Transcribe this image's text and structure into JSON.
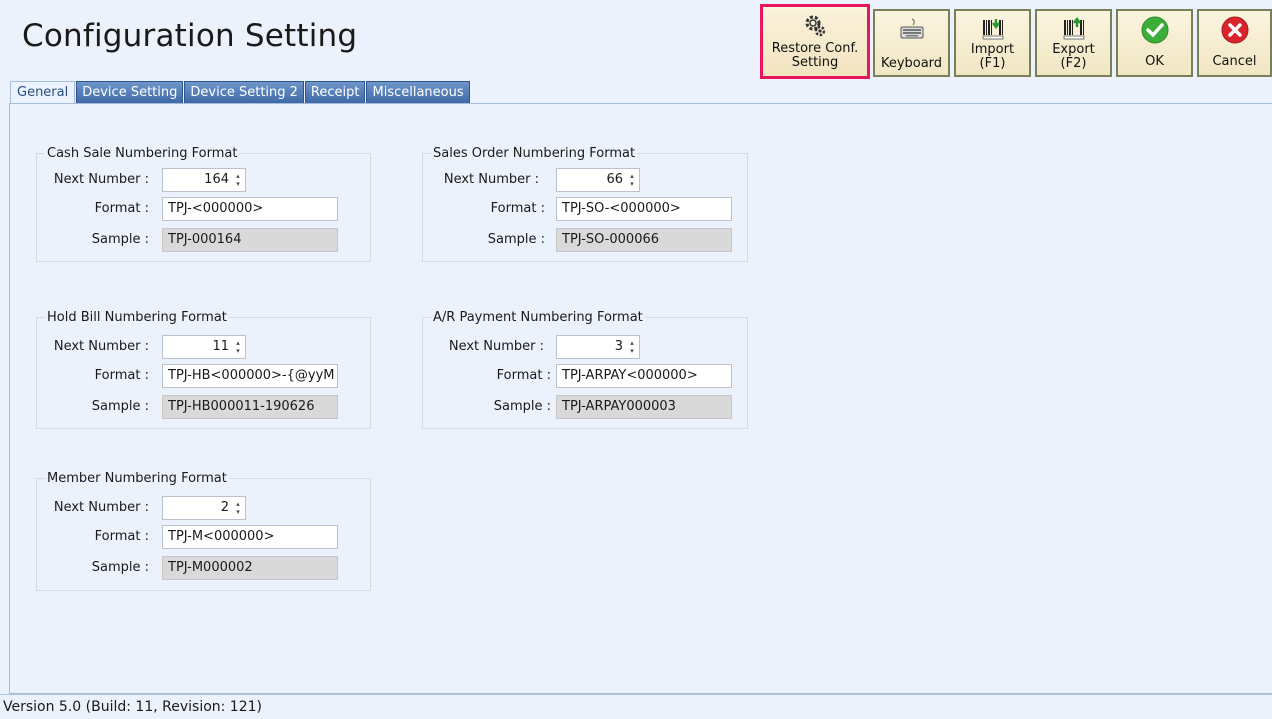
{
  "window": {
    "title": "Configuration Setting"
  },
  "toolbar": {
    "restore_label_1": "Restore Conf.",
    "restore_label_2": "Setting",
    "keyboard_label": "Keyboard",
    "import_label_1": "Import",
    "import_label_2": "(F1)",
    "export_label_1": "Export",
    "export_label_2": "(F2)",
    "ok_label": "OK",
    "cancel_label": "Cancel"
  },
  "tabs": [
    "General",
    "Device Setting",
    "Device Setting 2",
    "Receipt",
    "Miscellaneous"
  ],
  "labels": {
    "next_number": "Next Number :",
    "format": "Format :",
    "sample": "Sample :"
  },
  "groups": {
    "cash_sale": {
      "title": "Cash Sale Numbering Format",
      "next_number": "164",
      "format": "TPJ-<000000>",
      "sample": "TPJ-000164"
    },
    "sales_order": {
      "title": "Sales Order Numbering Format",
      "next_number": "66",
      "format": "TPJ-SO-<000000>",
      "sample": "TPJ-SO-000066"
    },
    "hold_bill": {
      "title": "Hold Bill Numbering Format",
      "next_number": "11",
      "format": "TPJ-HB<000000>-{@yyM",
      "sample": "TPJ-HB000011-190626"
    },
    "ar_payment": {
      "title": "A/R Payment Numbering Format",
      "next_number": "3",
      "format": "TPJ-ARPAY<000000>",
      "sample": "TPJ-ARPAY000003"
    },
    "member": {
      "title": "Member Numbering Format",
      "next_number": "2",
      "format": "TPJ-M<000000>",
      "sample": "TPJ-M000002"
    }
  },
  "status": {
    "version": "Version 5.0 (Build: 11, Revision: 121)"
  },
  "colors": {
    "accent_highlight": "#e8175d",
    "tab_blue": "#3f6aa8",
    "ok_green": "#3cae3a",
    "cancel_red": "#d9242b"
  }
}
